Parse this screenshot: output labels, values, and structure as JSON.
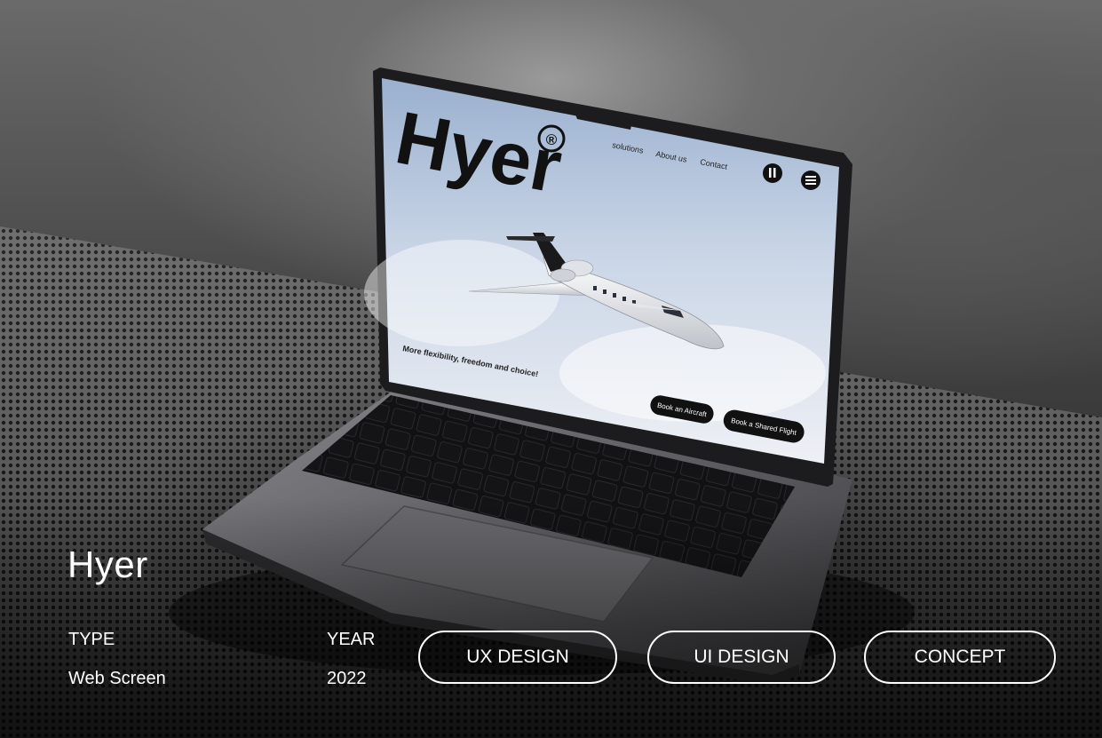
{
  "project": {
    "title": "Hyer",
    "type_label": "TYPE",
    "type_value": "Web Screen",
    "year_label": "YEAR",
    "year_value": "2022"
  },
  "tags": [
    "UX DESIGN",
    "UI DESIGN",
    "CONCEPT"
  ],
  "laptop_screen": {
    "brand": "Hyer",
    "registered_mark": "®",
    "nav": [
      "solutions",
      "About us",
      "Contact"
    ],
    "pause_icon": "pause-icon",
    "menu_icon": "menu-icon",
    "tagline": "More flexibility, freedom and choice!",
    "book_aircraft": "Book an Aircraft",
    "book_shared": "Book a Shared Flight"
  },
  "colors": {
    "text": "#ffffff",
    "screen_sky_top": "#9db1cf",
    "screen_sky_bottom": "#eef0f5",
    "laptop_body": "#5d5d61"
  }
}
